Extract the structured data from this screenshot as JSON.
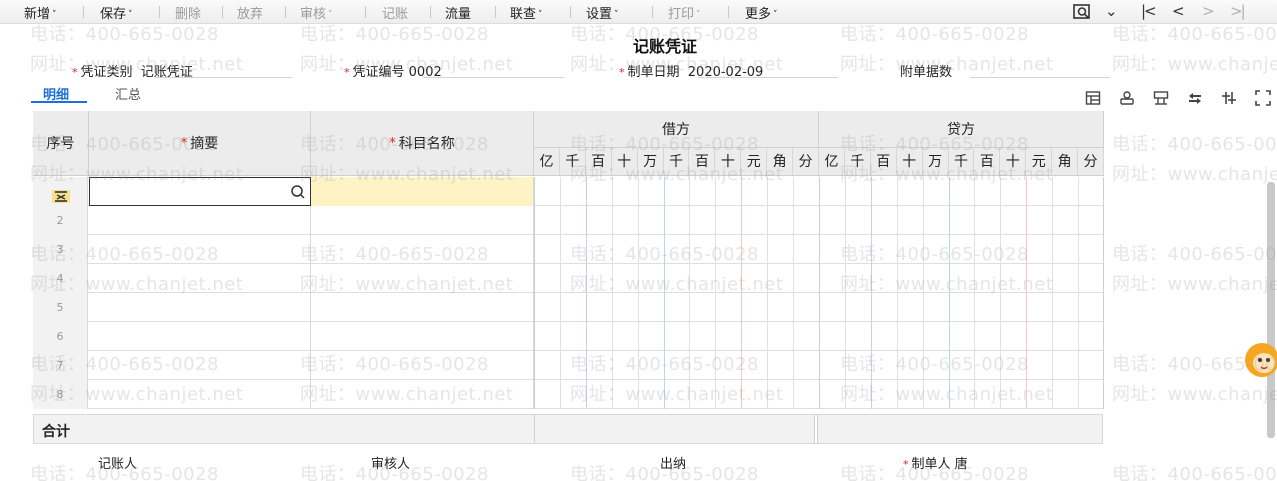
{
  "toolbar": {
    "items": [
      {
        "label": "新增",
        "enabled": true,
        "has_dropdown": true
      },
      {
        "label": "保存",
        "enabled": true,
        "has_dropdown": true
      },
      {
        "label": "删除",
        "enabled": false,
        "has_dropdown": false
      },
      {
        "label": "放弃",
        "enabled": false,
        "has_dropdown": false
      },
      {
        "label": "审核",
        "enabled": false,
        "has_dropdown": true
      },
      {
        "label": "记账",
        "enabled": false,
        "has_dropdown": false
      },
      {
        "label": "流量",
        "enabled": true,
        "has_dropdown": false
      },
      {
        "label": "联查",
        "enabled": true,
        "has_dropdown": true
      },
      {
        "label": "设置",
        "enabled": true,
        "has_dropdown": true
      },
      {
        "label": "打印",
        "enabled": false,
        "has_dropdown": true
      },
      {
        "label": "更多",
        "enabled": true,
        "has_dropdown": true
      }
    ],
    "caret": "˅",
    "nav": {
      "search_icon": "voucher-search-icon",
      "first": "|<",
      "prev": "<",
      "next": ">",
      "last": ">|"
    }
  },
  "voucher": {
    "title": "记账凭证",
    "type_label": "凭证类别",
    "type_value": "记账凭证",
    "number_label": "凭证编号",
    "number_value": "0002",
    "date_label": "制单日期",
    "date_value": "2020-02-09",
    "attachments_label": "附单据数",
    "attachments_value": ""
  },
  "tabs": [
    {
      "label": "明细",
      "active": true
    },
    {
      "label": "汇总",
      "active": false
    }
  ],
  "table_tools": [
    "insert-row-icon",
    "stamp-icon",
    "template-icon",
    "swap-icon",
    "balance-icon",
    "fullscreen-icon"
  ],
  "table": {
    "col_seq": "序号",
    "col_summary": "摘要",
    "col_account": "科目名称",
    "col_debit": "借方",
    "col_credit": "贷方",
    "digits": [
      "亿",
      "千",
      "百",
      "十",
      "万",
      "千",
      "百",
      "十",
      "元",
      "角",
      "分"
    ],
    "rows": [
      {
        "seq": "",
        "summary": "",
        "account": ""
      },
      {
        "seq": "2",
        "summary": "",
        "account": ""
      },
      {
        "seq": "3",
        "summary": "",
        "account": ""
      },
      {
        "seq": "4",
        "summary": "",
        "account": ""
      },
      {
        "seq": "5",
        "summary": "",
        "account": ""
      },
      {
        "seq": "6",
        "summary": "",
        "account": ""
      },
      {
        "seq": "7",
        "summary": "",
        "account": ""
      },
      {
        "seq": "8",
        "summary": "",
        "account": ""
      }
    ],
    "total_label": "合计"
  },
  "footer": {
    "bookkeeper_label": "记账人",
    "reviewer_label": "审核人",
    "cashier_label": "出纳",
    "preparer_label": "制单人",
    "preparer_value": "唐"
  },
  "watermark": {
    "phone": "电话：400-665-0028",
    "site": "网址：www.chanjet.net"
  },
  "colors": {
    "accent": "#1e6fd9",
    "required": "#e02020",
    "active_row": "#fdf3c4"
  }
}
